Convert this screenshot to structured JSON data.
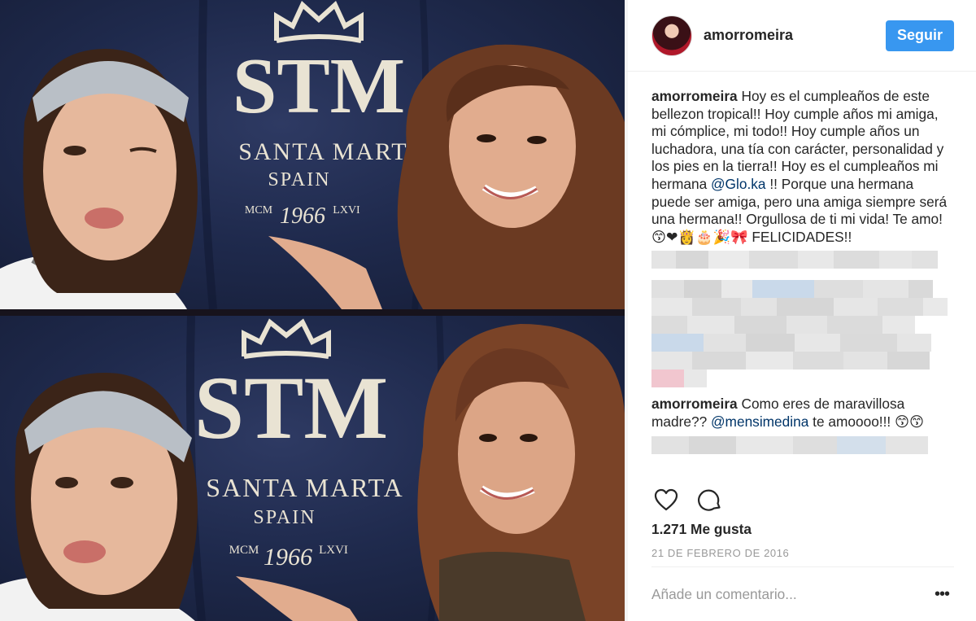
{
  "photo": {
    "brand_monogram": "STM",
    "brand_name": "SANTA MARTA",
    "brand_country": "SPAIN",
    "brand_year_left": "MCM",
    "brand_year": "1966",
    "brand_year_right": "LXVI"
  },
  "header": {
    "username": "amorromeira",
    "follow_label": "Seguir"
  },
  "caption": {
    "username": "amorromeira",
    "text_before_mention": " Hoy es el cumpleaños de este bellezon tropical!! Hoy cumple años mi amiga, mi cómplice, mi todo!! Hoy cumple años un luchadora, una tía con carácter, personalidad y los pies en la tierra!! Hoy es el cumpleaños mi hermana ",
    "mention": "@Glo.ka",
    "text_after_mention": " !! Porque una hermana puede ser amiga, pero una amiga siempre será una hermana!! Orgullosa de ti mi vida! Te amo! 😙❤👸🎂🎉🎀 FELICIDADES!!"
  },
  "comment_2": {
    "username": "amorromeira",
    "text_before_mention": " Como eres de maravillosa madre?? ",
    "mention": "@mensimedina",
    "text_after_mention": " te amoooo!!! 😙😙"
  },
  "likes": "1.271 Me gusta",
  "date": "21 de febrero de 2016",
  "add_comment": {
    "placeholder": "Añade un comentario...",
    "more_label": "•••"
  },
  "icons": {
    "like": "heart-icon",
    "comment": "comment-bubble-icon",
    "more": "more-options-icon"
  },
  "colors": {
    "follow_button": "#3897f0",
    "mention": "#003569",
    "backdrop": "#1f2a4d"
  }
}
